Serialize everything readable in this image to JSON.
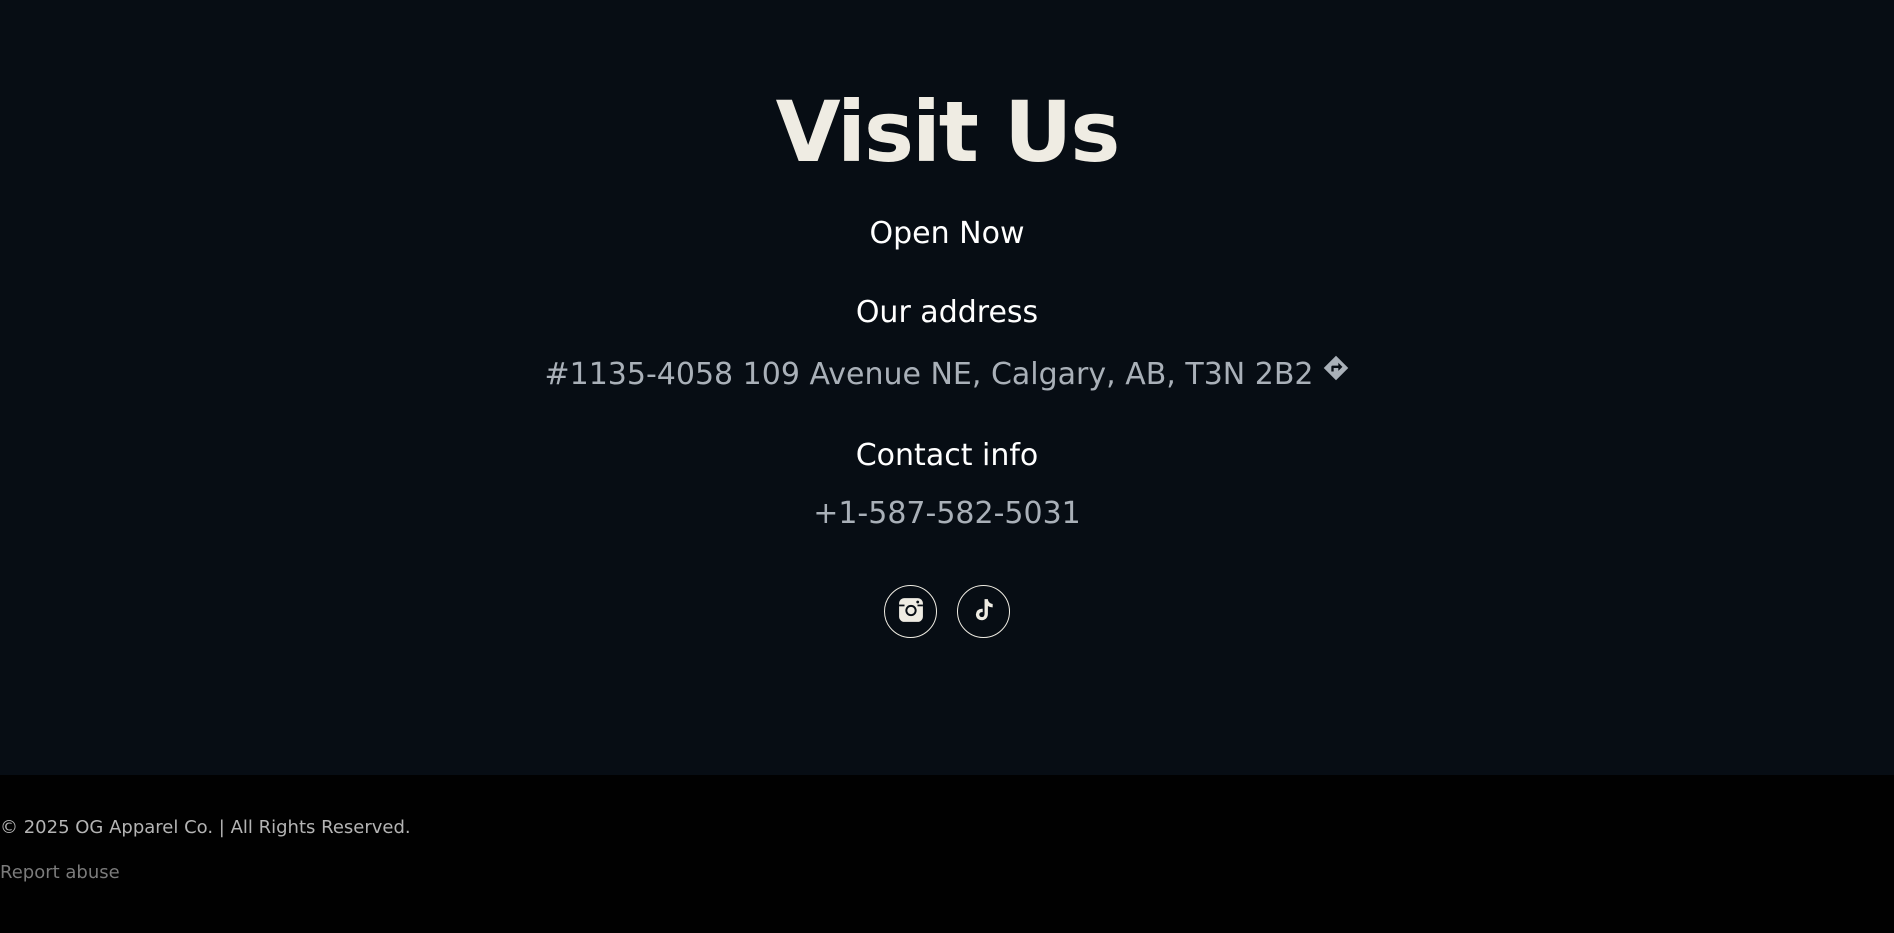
{
  "visit": {
    "title": "Visit Us",
    "status": "Open Now",
    "address_heading": "Our address",
    "address": "#1135-4058 109 Avenue NE, Calgary, AB, T3N 2B2",
    "directions_icon": "directions-icon",
    "contact_heading": "Contact info",
    "phone": "+1-587-582-5031"
  },
  "socials": [
    {
      "icon": "instagram-icon"
    },
    {
      "icon": "tiktok-icon"
    }
  ],
  "footer": {
    "copyright": "© 2025 OG Apparel Co. | All Rights Reserved.",
    "report": "Report abuse"
  },
  "colors": {
    "background": "#070d14",
    "footer_background": "#010101",
    "title": "#efece3",
    "muted_text": "#a9b0b8"
  }
}
